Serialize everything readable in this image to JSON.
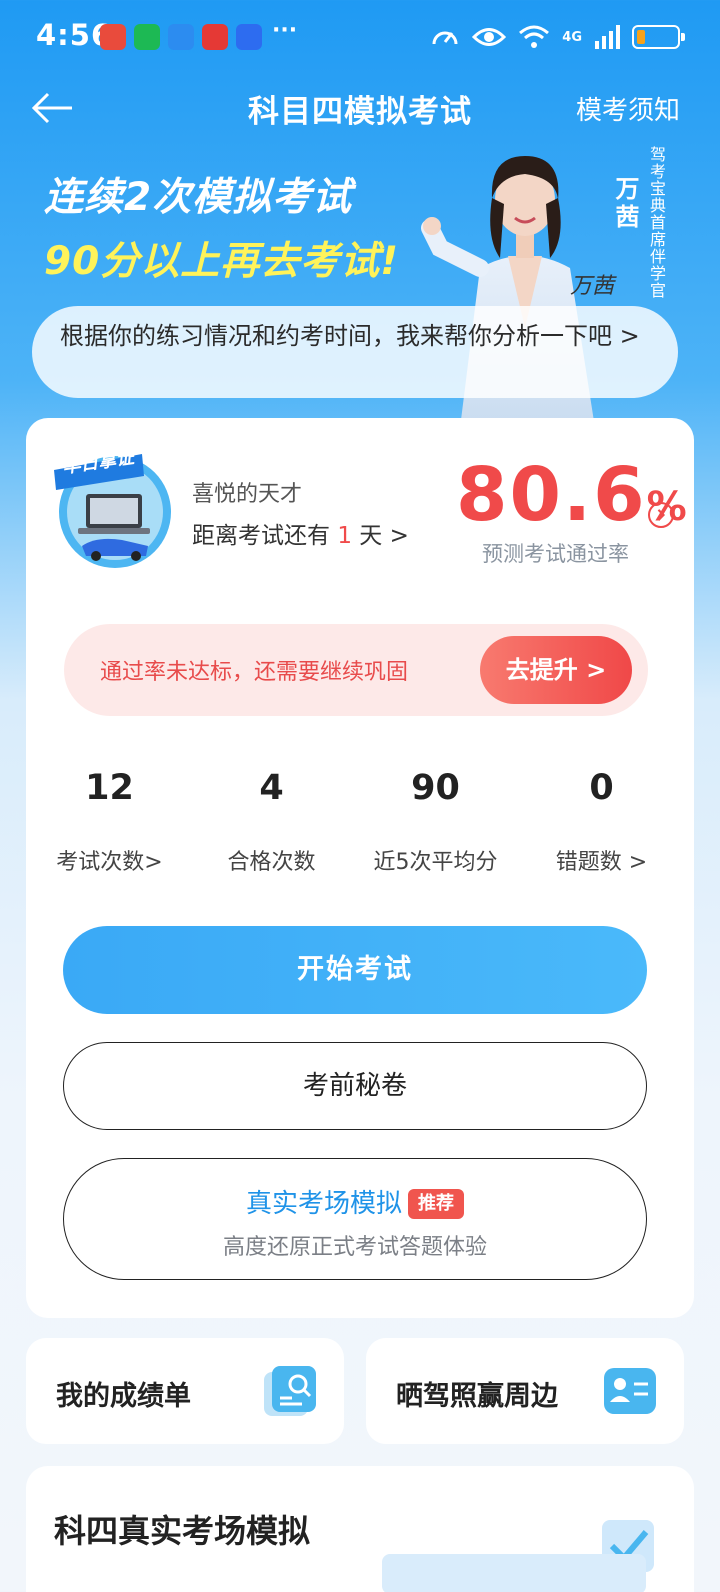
{
  "status_bar": {
    "time": "4:56",
    "more": "···",
    "network": "4G",
    "battery_level": 0.2,
    "app_icon_colors": [
      "#e94b3c",
      "#1db954",
      "#2c8cf0",
      "#e53935",
      "#2d6cf0"
    ]
  },
  "nav": {
    "title": "科目四模拟考试",
    "right_link": "模考须知"
  },
  "banner": {
    "line1": "连续2次模拟考试",
    "line2": "90分以上再去考试!",
    "person_name": "万茜",
    "person_role": "驾考宝典首席伴学官",
    "signature": "万茜",
    "analysis_text": "根据你的练习情况和约考时间，我来帮你分析一下吧 >"
  },
  "profile": {
    "avatar_badge": "早日拿证",
    "user_name": "喜悦的天才",
    "countdown_prefix": "距离考试还有",
    "countdown_days": "1",
    "countdown_suffix": "天 >",
    "pass_rate_value": "80.6",
    "pass_rate_unit": "%",
    "pass_rate_label": "预测考试通过率"
  },
  "warning": {
    "text": "通过率未达标，还需要继续巩固",
    "button": "去提升 >"
  },
  "stats": [
    {
      "value": "12",
      "label": "考试次数>"
    },
    {
      "value": "4",
      "label": "合格次数"
    },
    {
      "value": "90",
      "label": "近5次平均分"
    },
    {
      "value": "0",
      "label": "错题数 >"
    }
  ],
  "buttons": {
    "start": "开始考试",
    "secret": "考前秘卷",
    "real_title": "真实考场模拟",
    "real_badge": "推荐",
    "real_sub": "高度还原正式考试答题体验"
  },
  "mini_cards": {
    "report": "我的成绩单",
    "share": "晒驾照赢周边"
  },
  "section": {
    "title": "科四真实考场模拟"
  },
  "colors": {
    "primary_blue": "#1f9af3",
    "accent_red": "#f04a4a",
    "banner_yellow": "#fff35a"
  }
}
